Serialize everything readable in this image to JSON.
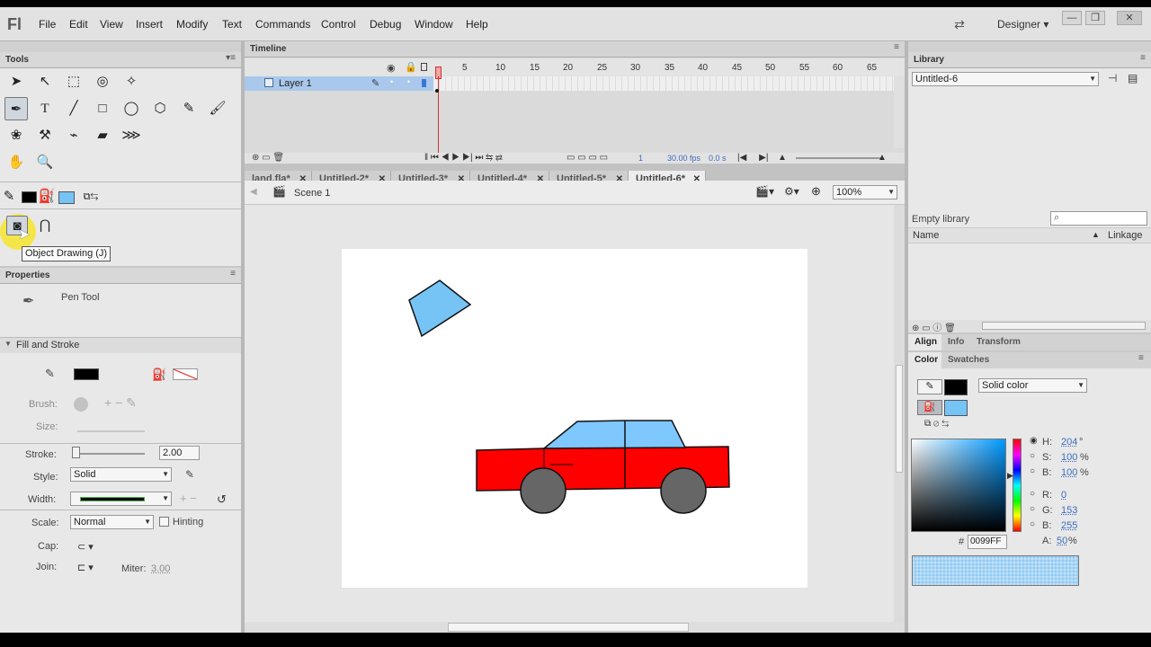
{
  "app": {
    "logo": "Fl",
    "workspace": "Designer"
  },
  "menu": [
    "File",
    "Edit",
    "View",
    "Insert",
    "Modify",
    "Text",
    "Commands",
    "Control",
    "Debug",
    "Window",
    "Help"
  ],
  "window_controls": {
    "minimize": "—",
    "restore": "❐",
    "close": "✕"
  },
  "tools_panel": {
    "title": "Tools",
    "tooltip": "Object Drawing (J)"
  },
  "properties": {
    "title": "Properties",
    "tool_name": "Pen Tool",
    "section": "Fill and Stroke",
    "brush_label": "Brush:",
    "size_label": "Size:",
    "stroke_label": "Stroke:",
    "stroke_value": "2.00",
    "style_label": "Style:",
    "style_value": "Solid",
    "width_label": "Width:",
    "scale_label": "Scale:",
    "scale_value": "Normal",
    "hinting_label": "Hinting",
    "cap_label": "Cap:",
    "join_label": "Join:",
    "miter_label": "Miter:",
    "miter_value": "3.00"
  },
  "timeline": {
    "title": "Timeline",
    "layer": "Layer 1",
    "frame_numbers": [
      "1",
      "5",
      "10",
      "15",
      "20",
      "25",
      "30",
      "35",
      "40",
      "45",
      "50",
      "55",
      "60",
      "65"
    ],
    "current_frame": "1",
    "fps": "30.00 fps",
    "time": "0.0 s"
  },
  "doc_tabs": [
    "land.fla*",
    "Untitled-2*",
    "Untitled-3*",
    "Untitled-4*",
    "Untitled-5*",
    "Untitled-6*"
  ],
  "edit_bar": {
    "scene": "Scene 1",
    "zoom": "100%"
  },
  "library": {
    "title": "Library",
    "document": "Untitled-6",
    "empty": "Empty library",
    "col_name": "Name",
    "col_linkage": "Linkage"
  },
  "align_tabs": [
    "Align",
    "Info",
    "Transform"
  ],
  "color_tabs": [
    "Color",
    "Swatches"
  ],
  "color": {
    "type": "Solid color",
    "h_label": "H:",
    "h": "204",
    "h_unit": "°",
    "s_label": "S:",
    "s": "100",
    "s_unit": "%",
    "b_label": "B:",
    "b": "100",
    "b_unit": "%",
    "r_label": "R:",
    "r": "0",
    "g_label": "G:",
    "g": "153",
    "bl_label": "B:",
    "bl": "255",
    "hex_label": "#",
    "hex": "0099FF",
    "a_label": "A:",
    "a": "50",
    "a_unit": "%"
  },
  "colors": {
    "stroke": "#000000",
    "fill": "#76c3f5",
    "car_body": "#ff0000",
    "window": "#7fc7ff",
    "wheel": "#666666"
  }
}
